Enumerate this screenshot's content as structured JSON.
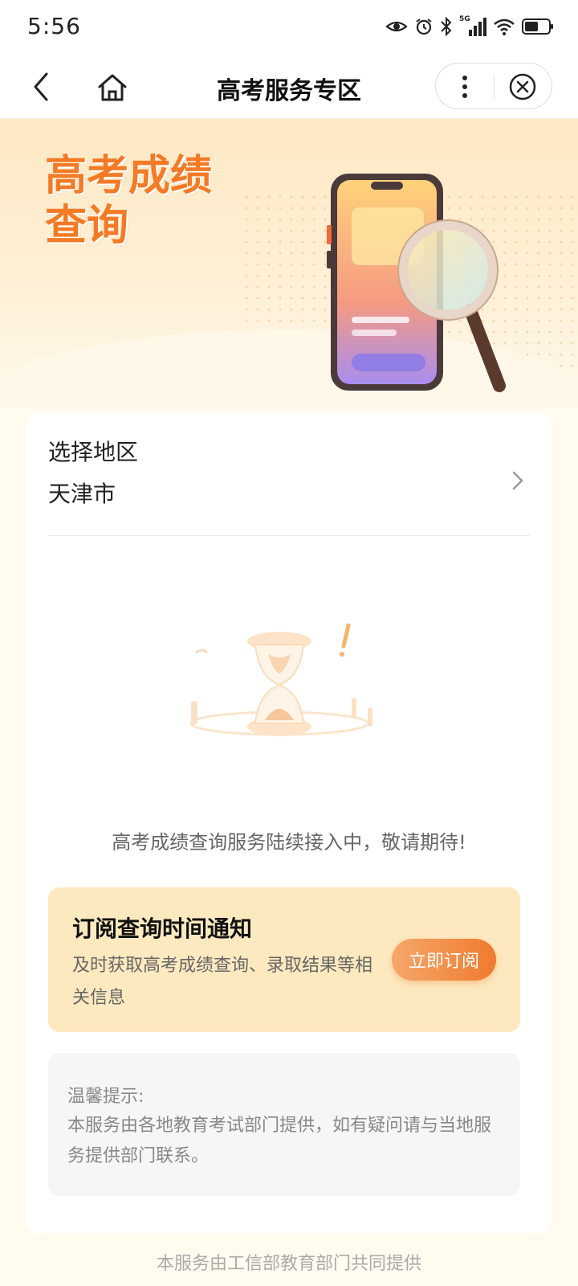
{
  "status": {
    "time": "5:56",
    "network": "5G"
  },
  "nav": {
    "title": "高考服务专区"
  },
  "hero": {
    "title_line1": "高考成绩",
    "title_line2": "查询"
  },
  "region": {
    "label": "选择地区",
    "value": "天津市"
  },
  "empty": {
    "message": "高考成绩查询服务陆续接入中，敬请期待!"
  },
  "subscribe": {
    "title": "订阅查询时间通知",
    "description": "及时获取高考成绩查询、录取结果等相关信息",
    "button": "立即订阅"
  },
  "tips": {
    "title": "温馨提示:",
    "body": "本服务由各地教育考试部门提供，如有疑问请与当地服务提供部门联系。"
  },
  "footer": {
    "note": "本服务由工信部教育部门共同提供"
  },
  "colors": {
    "accent": "#f47a25",
    "subscribe_bg": "#fde9bf"
  }
}
